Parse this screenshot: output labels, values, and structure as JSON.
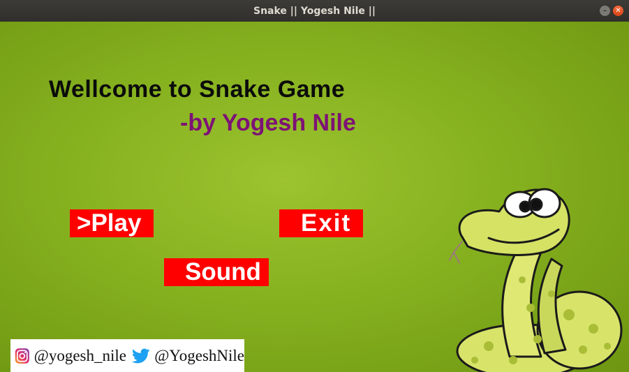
{
  "window": {
    "title": "Snake || Yogesh Nile ||"
  },
  "game": {
    "welcome_text": "Wellcome to Snake Game",
    "byline_text": "-by Yogesh Nile",
    "menu": {
      "play": ">Play",
      "exit": "Exit",
      "sound": "Sound"
    },
    "social": {
      "instagram": "@yogesh_nile",
      "twitter": "@YogeshNile"
    }
  },
  "colors": {
    "background": "#86b11f",
    "button": "#ff0000",
    "byline": "#7d1275"
  }
}
